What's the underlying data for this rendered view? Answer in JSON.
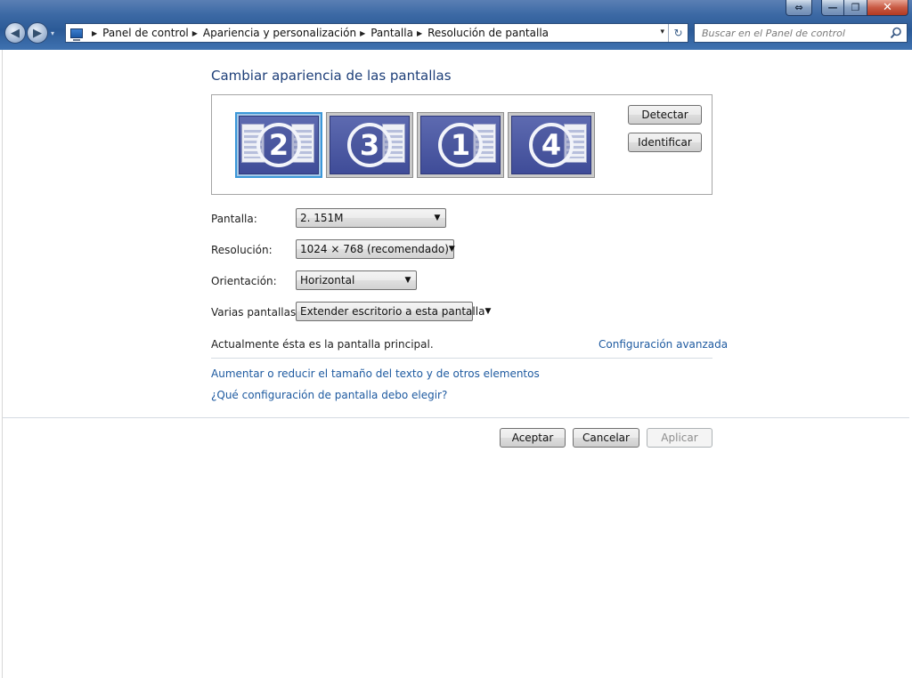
{
  "window": {
    "caption": {
      "swap": "⇔",
      "minimize": "—",
      "maximize": "❐",
      "close": "✕"
    }
  },
  "nav": {
    "back": "◀",
    "forward": "▶",
    "dropdown": "▾"
  },
  "address": {
    "crumbs": [
      "Panel de control",
      "Apariencia y personalización",
      "Pantalla",
      "Resolución de pantalla"
    ],
    "separator": "▶",
    "dropdown": "▾",
    "refresh": "↻"
  },
  "search": {
    "placeholder": "Buscar en el Panel de control"
  },
  "page": {
    "title": "Cambiar apariencia de las pantallas",
    "monitors": [
      {
        "number": "2",
        "selected": true
      },
      {
        "number": "3",
        "selected": false
      },
      {
        "number": "1",
        "selected": false
      },
      {
        "number": "4",
        "selected": false
      }
    ],
    "detect_label": "Detectar",
    "identify_label": "Identificar",
    "fields": {
      "display": {
        "label": "Pantalla:",
        "value": "2. 151M"
      },
      "resolution": {
        "label": "Resolución:",
        "value": "1024 × 768 (recomendado)"
      },
      "orientation": {
        "label": "Orientación:",
        "value": "Horizontal"
      },
      "multiple": {
        "label": "Varias pantallas:",
        "value": "Extender escritorio a esta pantalla"
      }
    },
    "status": "Actualmente ésta es la pantalla principal.",
    "advanced_link": "Configuración avanzada",
    "text_size_link": "Aumentar o reducir el tamaño del texto y de otros elementos",
    "help_link": "¿Qué configuración de pantalla debo elegir?",
    "ok_label": "Aceptar",
    "cancel_label": "Cancelar",
    "apply_label": "Aplicar"
  },
  "colors": {
    "link": "#1e5aa0",
    "title": "#1e3f79",
    "selected_border": "#3b97d8"
  }
}
